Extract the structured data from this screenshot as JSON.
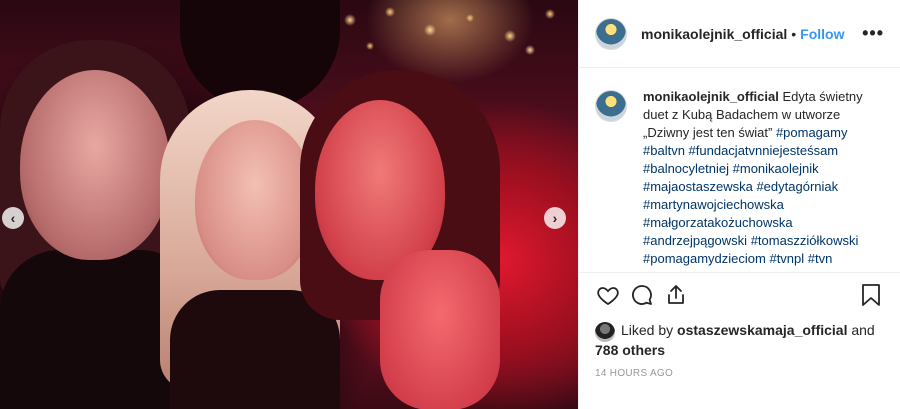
{
  "post": {
    "username": "monikaolejnik_official",
    "follow_label": "Follow",
    "more_label": "•••",
    "caption_user": "monikaolejnik_official",
    "caption_text": "Edyta świetny duet z Kubą Badachem w utworze „Dziwny jest ten świat”",
    "hashtags": [
      "#pomagamy",
      "#baltvn",
      "#fundacjatvnniejesteśsam",
      "#balnocyletniej",
      "#monikaolejnik",
      "#majaostaszewska",
      "#edytagórniak",
      "#martynawojciechowska",
      "#małgorzatakożuchowska",
      "#andrzejpągowski",
      "#tomaszziółkowski",
      "#pomagamydzieciom",
      "#tvnpl",
      "#tvn"
    ],
    "liked_by_prefix": "Liked by",
    "liked_by_user": "ostaszewskamaja_official",
    "liked_by_and": "and",
    "others": "788 others",
    "timestamp": "14 HOURS AGO"
  },
  "carousel": {
    "prev_label": "‹",
    "next_label": "›"
  },
  "icons": [
    "heart-icon",
    "comment-icon",
    "share-icon",
    "bookmark-icon"
  ],
  "colors": {
    "link": "#3897f0",
    "hashtag": "#003569",
    "text": "#262626",
    "muted": "#999999"
  }
}
